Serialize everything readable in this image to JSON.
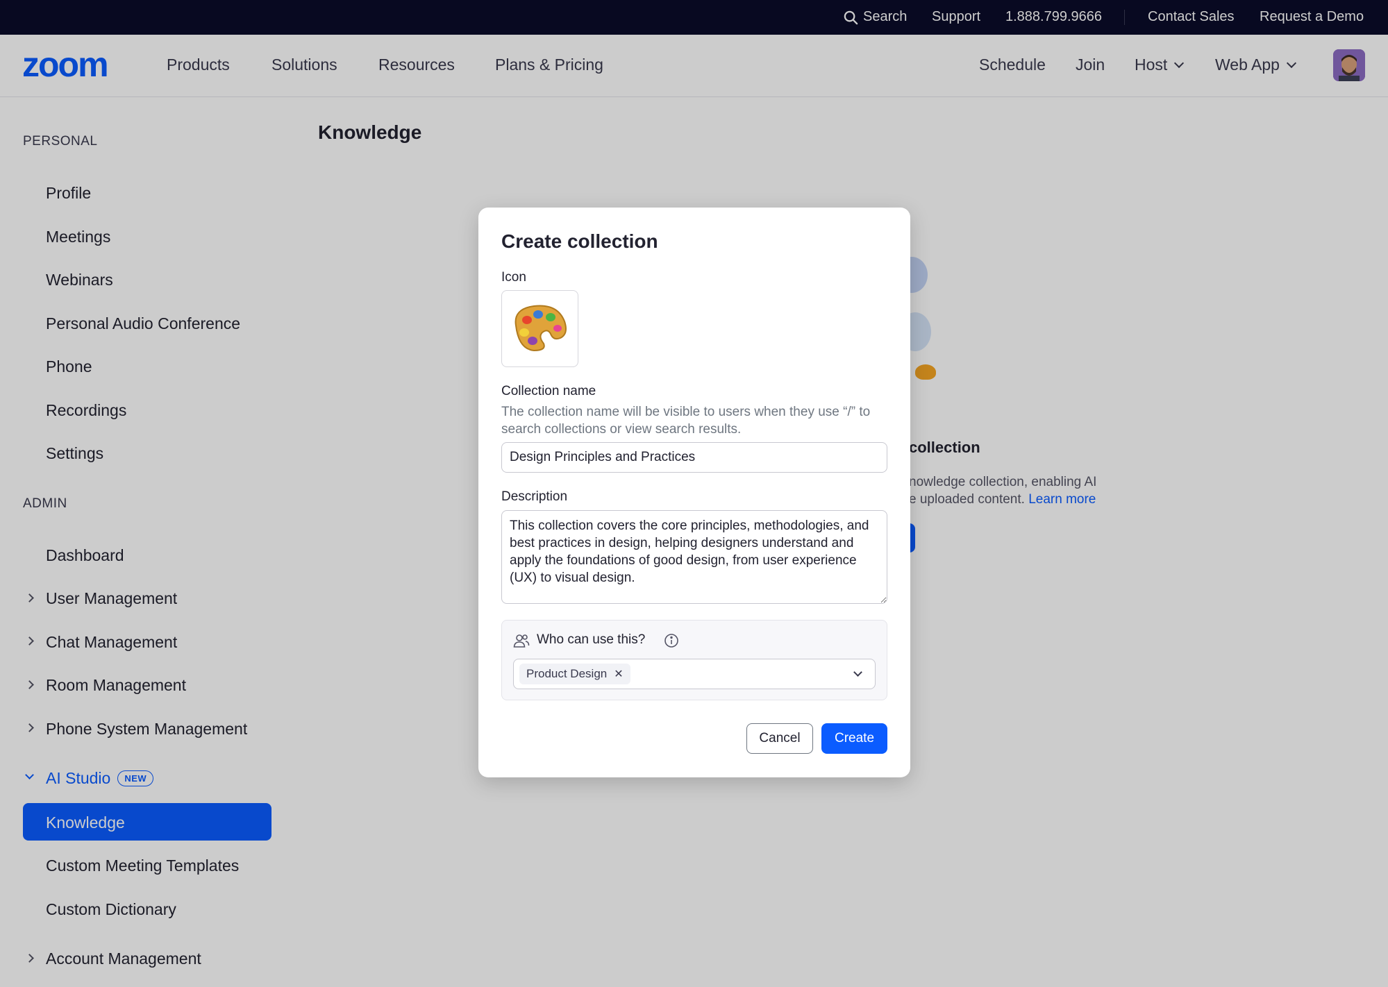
{
  "topbar": {
    "search_label": "Search",
    "support_label": "Support",
    "phone": "1.888.799.9666",
    "contact_sales_label": "Contact Sales",
    "request_demo_label": "Request a Demo"
  },
  "nav": {
    "logo_text": "zoom",
    "products_label": "Products",
    "solutions_label": "Solutions",
    "resources_label": "Resources",
    "plans_label": "Plans & Pricing",
    "schedule_label": "Schedule",
    "join_label": "Join",
    "host_label": "Host",
    "webapp_label": "Web App",
    "brand_color": "#0b5cff"
  },
  "sidebar": {
    "personal_heading": "PERSONAL",
    "personal_items": [
      "Profile",
      "Meetings",
      "Webinars",
      "Personal Audio Conference",
      "Phone",
      "Recordings",
      "Settings"
    ],
    "admin_heading": "ADMIN",
    "dashboard_label": "Dashboard",
    "collapsible_items": [
      "User Management",
      "Chat Management",
      "Room Management",
      "Phone System Management"
    ],
    "ai_studio_label": "AI Studio",
    "new_badge": "NEW",
    "ai_studio_items": [
      "Knowledge",
      "Custom Meeting Templates",
      "Custom Dictionary"
    ],
    "account_management_label": "Account Management"
  },
  "content": {
    "page_title": "Knowledge",
    "bg_heading": "collection",
    "bg_text_line1": "nowledge collection, enabling AI",
    "bg_text_line2": "e uploaded content.",
    "bg_link": "Learn more"
  },
  "modal": {
    "title": "Create collection",
    "icon_label": "Icon",
    "icon_name": "palette-icon",
    "name_label": "Collection name",
    "name_help": "The collection name will be visible to users when they use “/” to search collections or view search results.",
    "name_value": "Design Principles and Practices",
    "description_label": "Description",
    "description_value": "This collection covers the core principles, methodologies, and best practices in design, helping designers understand and apply the foundations of good design, from user experience (UX) to visual design.",
    "access_label": "Who can use this?",
    "selected_chip": "Product Design",
    "cancel_label": "Cancel",
    "create_label": "Create"
  }
}
